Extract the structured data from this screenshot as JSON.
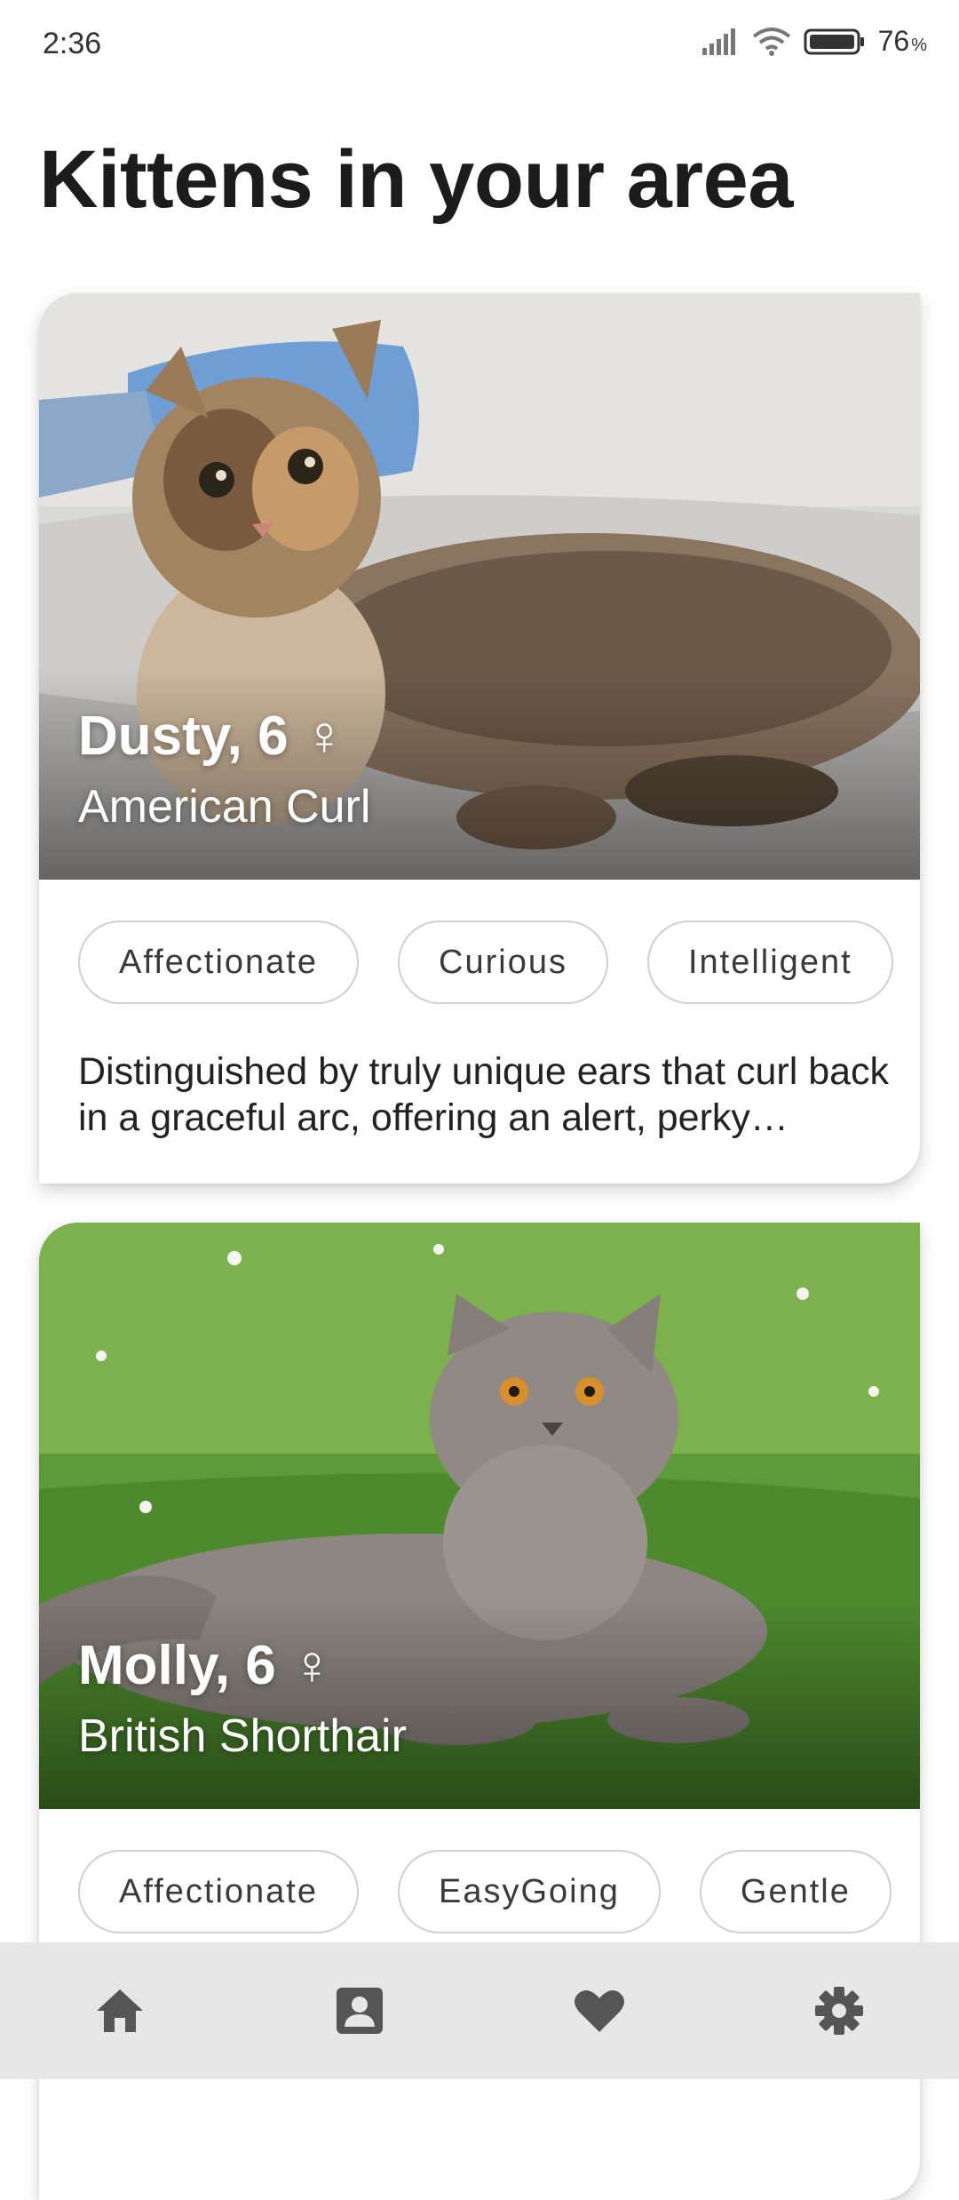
{
  "status_bar": {
    "time": "2:36",
    "battery_percent": "76",
    "battery_unit": "%",
    "icons": [
      "signal-icon",
      "wifi-icon",
      "battery-icon"
    ]
  },
  "page": {
    "title": "Kittens in your area"
  },
  "cards": [
    {
      "name": "Dusty, 6 ♀",
      "breed": "American Curl",
      "tags": [
        "Affectionate",
        "Curious",
        "Intelligent"
      ],
      "description": "Distinguished by truly unique ears that curl back in a graceful arc, offering an alert, perky…"
    },
    {
      "name": "Molly, 6 ♀",
      "breed": "British Shorthair",
      "tags": [
        "Affectionate",
        "EasyGoing",
        "Gentle"
      ]
    }
  ],
  "bottom_nav": {
    "items": [
      {
        "icon": "home-icon"
      },
      {
        "icon": "profile-icon"
      },
      {
        "icon": "heart-icon"
      },
      {
        "icon": "settings-icon"
      }
    ]
  },
  "colors": {
    "nav_background": "#e6e6e6",
    "nav_icon": "#555555",
    "chip_border": "#cfcfcf",
    "title": "#1c1c1c"
  }
}
